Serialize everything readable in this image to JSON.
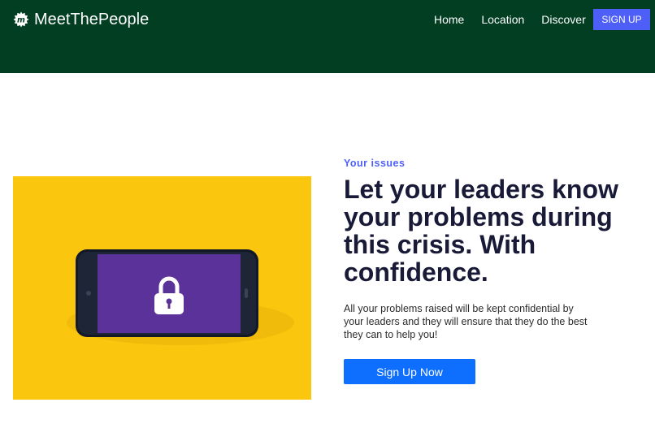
{
  "header": {
    "brand_name": "MeetThePeople",
    "logo_icon": "brand-logo-icon",
    "background_color": "#013e22",
    "nav_links": [
      {
        "label": "Home"
      },
      {
        "label": "Location"
      },
      {
        "label": "Discover"
      }
    ],
    "signup_label": "SIGN UP",
    "signup_color": "#4e5ff7"
  },
  "hero": {
    "image_icon": "phone-lock-icon",
    "image_background": "#fbc60e",
    "eyebrow": "Your issues",
    "headline": "Let your leaders know your problems during this crisis. With confidence.",
    "lead": "All your problems raised will be kept confidential by your leaders and they will ensure that they do the best they can to help you!",
    "cta_label": "Sign Up Now",
    "cta_color": "#0e6efd"
  }
}
